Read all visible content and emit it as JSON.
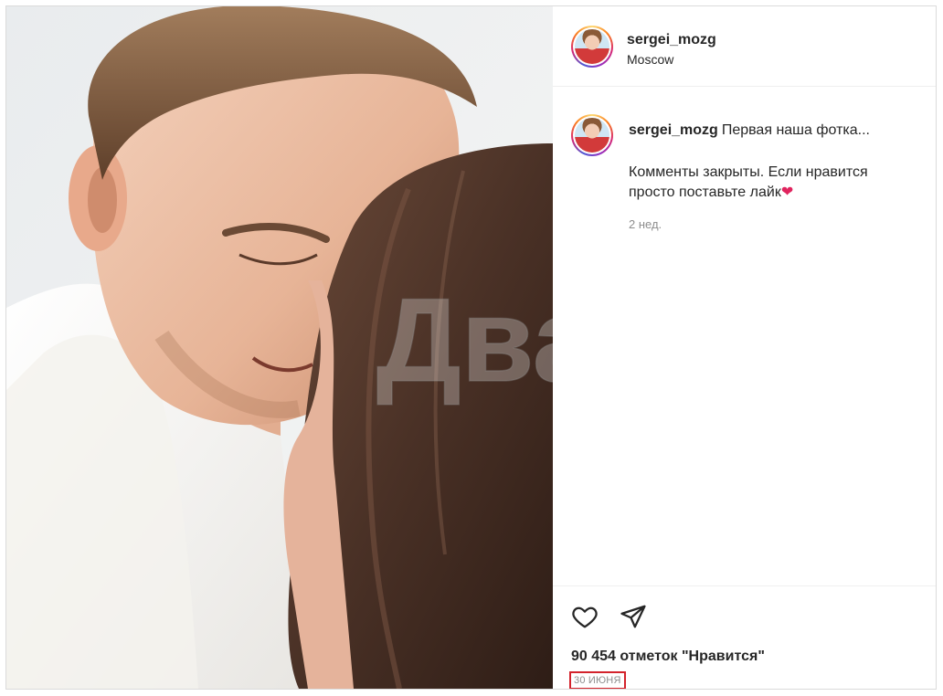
{
  "post": {
    "author": {
      "username": "sergei_mozg",
      "location": "Moscow"
    },
    "caption": {
      "username": "sergei_mozg",
      "first_line": "Первая наша фотка...",
      "body": "Комменты закрыты. Если нравится просто поставьте лайк",
      "emoji": "❤",
      "age": "2 нед."
    },
    "watermark": "Двач",
    "likes_text": "90 454 отметок \"Нравится\"",
    "date": "30 ИЮНЯ"
  },
  "icons": {
    "like": "heart-outline-icon",
    "share": "paper-plane-icon"
  },
  "colors": {
    "text": "#262626",
    "muted": "#8e8e8e",
    "border": "#dbdbdb",
    "highlight": "#d3232c"
  }
}
